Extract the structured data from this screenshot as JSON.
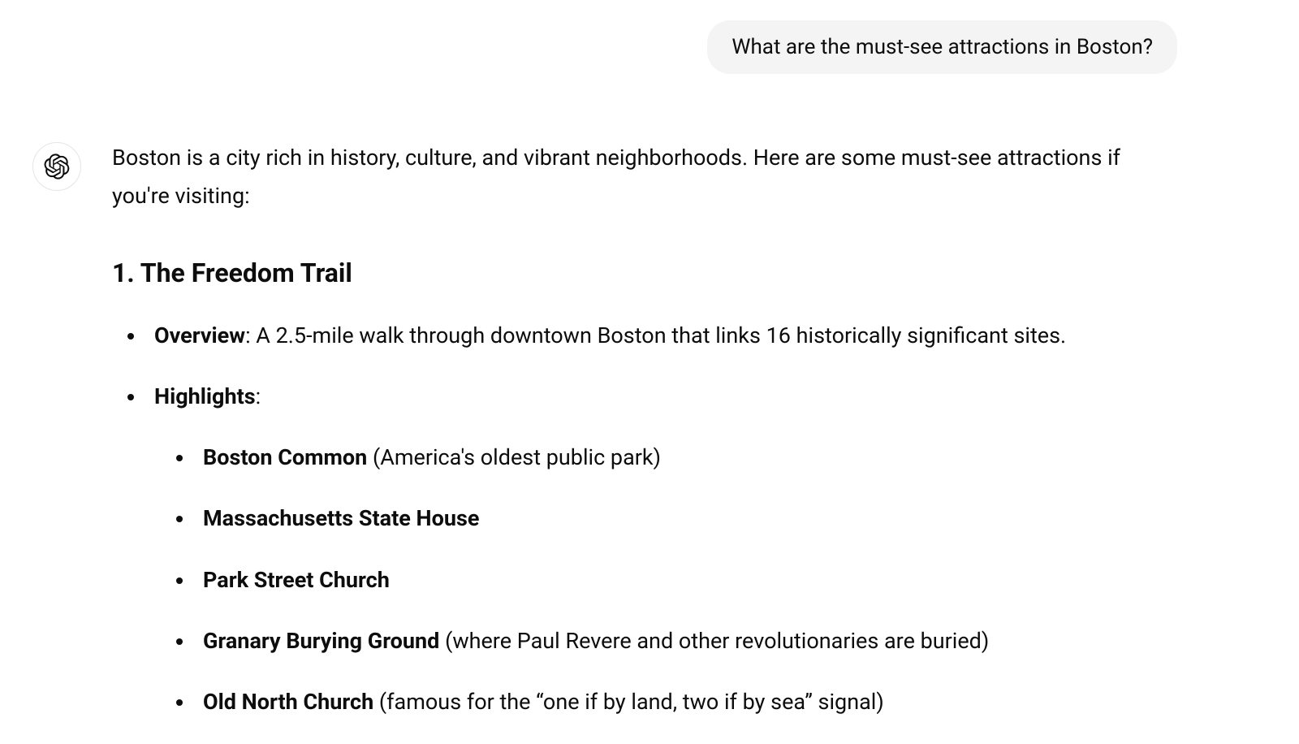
{
  "user_message": "What are the must-see attractions in Boston?",
  "assistant": {
    "intro": "Boston is a city rich in history, culture, and vibrant neighborhoods. Here are some must-see attractions if you're visiting:",
    "section": {
      "number": "1.",
      "title": "The Freedom Trail",
      "overview_label": "Overview",
      "overview_text": ": A 2.5-mile walk through downtown Boston that links 16 historically significant sites.",
      "highlights_label": "Highlights",
      "highlights_colon": ":",
      "highlights": [
        {
          "bold": "Boston Common",
          "rest": " (America's oldest public park)"
        },
        {
          "bold": "Massachusetts State House",
          "rest": ""
        },
        {
          "bold": "Park Street Church",
          "rest": ""
        },
        {
          "bold": "Granary Burying Ground",
          "rest": " (where Paul Revere and other revolutionaries are buried)"
        },
        {
          "bold": "Old North Church",
          "rest": " (famous for the “one if by land, two if by sea” signal)"
        }
      ]
    }
  }
}
